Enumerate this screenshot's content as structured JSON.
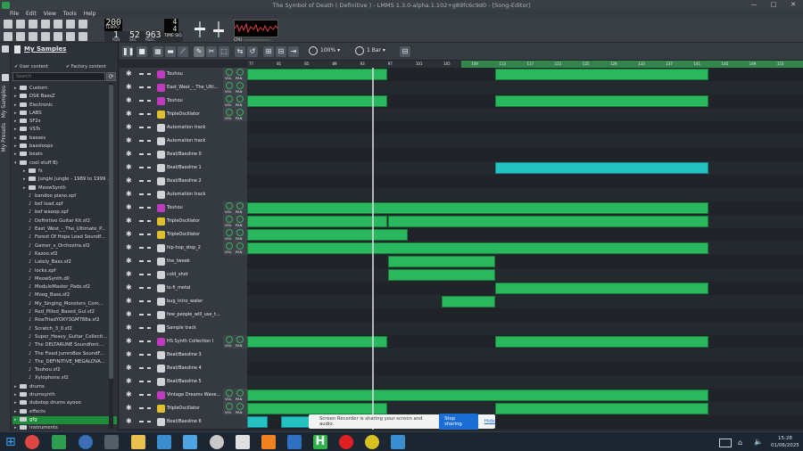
{
  "window": {
    "title": "The Symbol of Death ( Definitive ) - LMMS 1.3.0-alpha.1.102+g89fc6c9d0 - [Song-Editor]",
    "controls": [
      "—",
      "□",
      "✕"
    ]
  },
  "menu": [
    "File",
    "Edit",
    "View",
    "Tools",
    "Help"
  ],
  "transport": {
    "tempo": "200",
    "tempo_label": "TEMPO",
    "min": "1",
    "sec": "52",
    "msec": "963",
    "min_label": "MIN",
    "sec_label": "SEC",
    "msec_label": "MSEC",
    "timesig_num": "4",
    "timesig_den": "4",
    "timesig_label": "TIME SIG",
    "cpu_label": "CPU"
  },
  "sidebar_tabs": [
    "My Samples",
    "My Presets"
  ],
  "browser": {
    "title": "My Samples",
    "user_content": "User content",
    "factory_content": "Factory content",
    "search_placeholder": "Search",
    "tree": [
      {
        "label": "Custom",
        "depth": 0,
        "type": "folder",
        "arrow": "▸"
      },
      {
        "label": "DSK BassZ",
        "depth": 0,
        "type": "folder",
        "arrow": "▸"
      },
      {
        "label": "Electronic",
        "depth": 0,
        "type": "folder",
        "arrow": "▸"
      },
      {
        "label": "LABS",
        "depth": 0,
        "type": "folder",
        "arrow": "▸"
      },
      {
        "label": "SF2s",
        "depth": 0,
        "type": "folder",
        "arrow": "▸"
      },
      {
        "label": "VSTs",
        "depth": 0,
        "type": "folder",
        "arrow": "▸"
      },
      {
        "label": "basses",
        "depth": 0,
        "type": "folder",
        "arrow": "▸"
      },
      {
        "label": "bassloops",
        "depth": 0,
        "type": "folder",
        "arrow": "▸"
      },
      {
        "label": "beats",
        "depth": 0,
        "type": "folder",
        "arrow": "▸"
      },
      {
        "label": "cool stuff B)",
        "depth": 0,
        "type": "folder",
        "arrow": "▾"
      },
      {
        "label": "fs",
        "depth": 1,
        "type": "folder",
        "arrow": "▸"
      },
      {
        "label": "Jungle Jungle - 1989 to 1999 ...",
        "depth": 1,
        "type": "folder",
        "arrow": "▸"
      },
      {
        "label": "MeowSynth",
        "depth": 1,
        "type": "folder",
        "arrow": "▸"
      },
      {
        "label": "bandoo piano.xpf",
        "depth": 1,
        "type": "file",
        "arrow": ""
      },
      {
        "label": "bef lead.xpf",
        "depth": 1,
        "type": "file",
        "arrow": ""
      },
      {
        "label": "bef waoop.xpf",
        "depth": 1,
        "type": "file",
        "arrow": ""
      },
      {
        "label": "Definitive Guitar Kit.sf2",
        "depth": 1,
        "type": "file",
        "arrow": ""
      },
      {
        "label": "East_West_-_The_Ultimate_P...",
        "depth": 1,
        "type": "file",
        "arrow": ""
      },
      {
        "label": "Forest Of Hope Lead Soundf...",
        "depth": 1,
        "type": "file",
        "arrow": ""
      },
      {
        "label": "Gamer_s_Orchestra.sf2",
        "depth": 1,
        "type": "file",
        "arrow": ""
      },
      {
        "label": "Kazoo.sf2",
        "depth": 1,
        "type": "file",
        "arrow": ""
      },
      {
        "label": "Lately_Bass.sf2",
        "depth": 1,
        "type": "file",
        "arrow": ""
      },
      {
        "label": "locks.xpf",
        "depth": 1,
        "type": "file",
        "arrow": ""
      },
      {
        "label": "MeowSynth.dll",
        "depth": 1,
        "type": "file",
        "arrow": ""
      },
      {
        "label": "ModuleMaster_Pads.sf2",
        "depth": 1,
        "type": "file",
        "arrow": ""
      },
      {
        "label": "Moog_Bass.sf2",
        "depth": 1,
        "type": "file",
        "arrow": ""
      },
      {
        "label": "My_Singing_Monsters_Com...",
        "depth": 1,
        "type": "file",
        "arrow": ""
      },
      {
        "label": "Red_Pilled_Based_Gui.sf2",
        "depth": 1,
        "type": "file",
        "arrow": ""
      },
      {
        "label": "RiseTriadYOXY3GMT88a.sf2",
        "depth": 1,
        "type": "file",
        "arrow": ""
      },
      {
        "label": "Scratch_3_0.sf2",
        "depth": 1,
        "type": "file",
        "arrow": ""
      },
      {
        "label": "Super_Heavy_Guitar_Collecti...",
        "depth": 1,
        "type": "file",
        "arrow": ""
      },
      {
        "label": "The DELTARUNE Soundfont....",
        "depth": 1,
        "type": "file",
        "arrow": ""
      },
      {
        "label": "The Fixed JummBox SoundF...",
        "depth": 1,
        "type": "file",
        "arrow": ""
      },
      {
        "label": "The_DEFINITIVE_MEGALOVA...",
        "depth": 1,
        "type": "file",
        "arrow": ""
      },
      {
        "label": "Touhou.sf2",
        "depth": 1,
        "type": "file",
        "arrow": ""
      },
      {
        "label": "Xylophone.sf2",
        "depth": 1,
        "type": "file",
        "arrow": ""
      },
      {
        "label": "drums",
        "depth": 0,
        "type": "folder",
        "arrow": "▸"
      },
      {
        "label": "drumsynth",
        "depth": 0,
        "type": "folder",
        "arrow": "▸"
      },
      {
        "label": "dubstep drums ayooo",
        "depth": 0,
        "type": "folder",
        "arrow": "▸"
      },
      {
        "label": "effects",
        "depth": 0,
        "type": "folder",
        "arrow": "▸"
      },
      {
        "label": "gfg",
        "depth": 0,
        "type": "folder",
        "arrow": "▸",
        "selected": true
      },
      {
        "label": "instruments",
        "depth": 0,
        "type": "folder",
        "arrow": "▸"
      }
    ]
  },
  "song_editor": {
    "zoom": "100%",
    "snap": "1 Bar",
    "ticks": [
      "77",
      "81",
      "85",
      "89",
      "93",
      "97",
      "101",
      "105",
      "109",
      "113",
      "117",
      "121",
      "125",
      "129",
      "133",
      "137",
      "141",
      "145",
      "149",
      "153"
    ],
    "tracks": [
      {
        "name": "Touhou",
        "icon": "sf2",
        "knobs": true
      },
      {
        "name": "East_West_-_The_Ulti...",
        "icon": "sf2",
        "knobs": true
      },
      {
        "name": "Touhou",
        "icon": "sf2",
        "knobs": true
      },
      {
        "name": "TripleOscillator",
        "icon": "osc",
        "knobs": true
      },
      {
        "name": "Automation track",
        "icon": "auto",
        "knobs": false
      },
      {
        "name": "Automation track",
        "icon": "auto",
        "knobs": false
      },
      {
        "name": "Beat/Bassline 0",
        "icon": "bb",
        "knobs": false
      },
      {
        "name": "Beat/Bassline 1",
        "icon": "bb",
        "knobs": false
      },
      {
        "name": "Beat/Bassline 2",
        "icon": "bb",
        "knobs": false
      },
      {
        "name": "Automation track",
        "icon": "auto",
        "knobs": false
      },
      {
        "name": "Touhou",
        "icon": "sf2",
        "knobs": true
      },
      {
        "name": "TripleOscillator",
        "icon": "osc",
        "knobs": true
      },
      {
        "name": "TripleOscillator",
        "icon": "osc",
        "knobs": true
      },
      {
        "name": "hip-hop_stop_2",
        "icon": "sample",
        "knobs": true
      },
      {
        "name": "the_tweek",
        "icon": "sample",
        "knobs": false
      },
      {
        "name": "cold_shot",
        "icon": "sample",
        "knobs": false
      },
      {
        "name": "lo-fi_metal",
        "icon": "sample",
        "knobs": false
      },
      {
        "name": "bug_intro_water",
        "icon": "sample",
        "knobs": false
      },
      {
        "name": "few_people_will_use_t...",
        "icon": "sample",
        "knobs": false
      },
      {
        "name": "Sample track",
        "icon": "sample",
        "knobs": false
      },
      {
        "name": "HS Synth Collection I",
        "icon": "sf2",
        "knobs": true
      },
      {
        "name": "Beat/Bassline 3",
        "icon": "bb",
        "knobs": false
      },
      {
        "name": "Beat/Bassline 4",
        "icon": "bb",
        "knobs": false
      },
      {
        "name": "Beat/Bassline 5",
        "icon": "bb",
        "knobs": false
      },
      {
        "name": "Vintage Dreams Wave...",
        "icon": "sf2",
        "knobs": true
      },
      {
        "name": "TripleOscillator",
        "icon": "osc",
        "knobs": true
      },
      {
        "name": "Beat/Bassline 6",
        "icon": "bb",
        "knobs": false
      }
    ],
    "knob_labels": {
      "vol": "VOL",
      "pan": "PAN"
    }
  },
  "notification": {
    "text": "Screen Recorder is sharing your screen and audio.",
    "share": "Stop sharing",
    "hide": "Hide"
  },
  "taskbar": {
    "time": "15:28",
    "date": "01/06/2025"
  },
  "colors": {
    "clip": "#2ab85f",
    "bb_clip": "#25c2c2",
    "accent": "#1e8c3a"
  }
}
